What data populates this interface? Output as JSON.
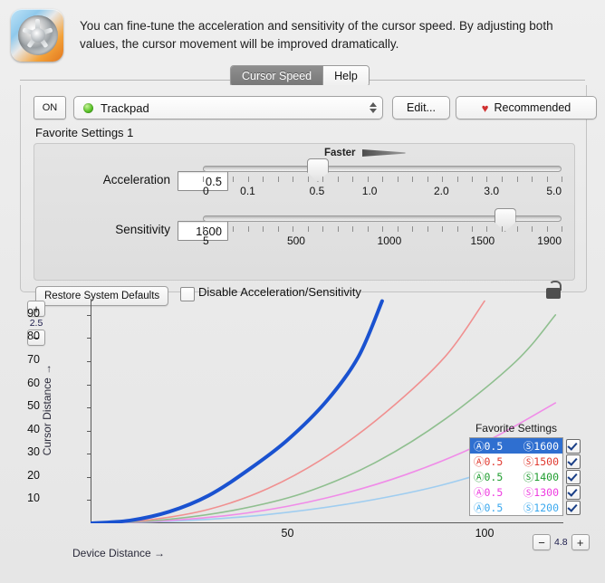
{
  "header": {
    "icon_name": "turbine-app-icon",
    "description": "You can fine-tune the acceleration and sensitivity of the cursor speed. By adjusting both values, the cursor movement will be improved dramatically."
  },
  "tabs": [
    {
      "label": "Cursor Speed",
      "active": true
    },
    {
      "label": "Help",
      "active": false
    }
  ],
  "toolbar": {
    "on_label": "ON",
    "device_value": "Trackpad",
    "device_led_color": "#5cc52a",
    "edit_label": "Edit...",
    "recommended_label": "Recommended",
    "heart_glyph": "♥",
    "help_label": "?"
  },
  "favorite": {
    "group_label": "Favorite Settings 1",
    "faster_label": "Faster"
  },
  "sliders": [
    {
      "name": "acceleration",
      "label": "Acceleration",
      "value": "0.5",
      "thumb_pct": 31.8,
      "ticks": 25,
      "tick_labels": [
        {
          "text": "0",
          "pct": 0
        },
        {
          "text": "0.1",
          "pct": 12.5
        },
        {
          "text": "0.5",
          "pct": 31.8
        },
        {
          "text": "1.0",
          "pct": 46.5
        },
        {
          "text": "2.0",
          "pct": 66.5
        },
        {
          "text": "3.0",
          "pct": 80.5
        },
        {
          "text": "5.0",
          "pct": 100
        }
      ]
    },
    {
      "name": "sensitivity",
      "label": "Sensitivity",
      "value": "1600",
      "thumb_pct": 84.0,
      "ticks": 25,
      "tick_labels": [
        {
          "text": "5",
          "pct": 0
        },
        {
          "text": "500",
          "pct": 26
        },
        {
          "text": "1000",
          "pct": 52
        },
        {
          "text": "1500",
          "pct": 78
        },
        {
          "text": "1900",
          "pct": 100
        }
      ]
    }
  ],
  "bottom": {
    "restore_label": "Restore System Defaults",
    "disable_label": "Disable Acceleration/Sensitivity",
    "disable_checked": false,
    "lock_state": "unlocked"
  },
  "chart_data": {
    "type": "line",
    "title": "",
    "xlabel": "Device Distance",
    "ylabel": "Cursor Distance",
    "xlim": [
      0,
      120
    ],
    "ylim": [
      0,
      97
    ],
    "x_ticks": [
      {
        "value": 50,
        "label": "50"
      },
      {
        "value": 100,
        "label": "100"
      }
    ],
    "y_ticks": [
      {
        "value": 10,
        "label": "10"
      },
      {
        "value": 20,
        "label": "20"
      },
      {
        "value": 30,
        "label": "30"
      },
      {
        "value": 40,
        "label": "40"
      },
      {
        "value": 50,
        "label": "50"
      },
      {
        "value": 60,
        "label": "60"
      },
      {
        "value": 70,
        "label": "70"
      },
      {
        "value": 80,
        "label": "80"
      },
      {
        "value": 90,
        "label": "90"
      }
    ],
    "grid": false,
    "legend_position": "bottom-right",
    "y_zoom": "2.5",
    "x_zoom": "4.8",
    "series": [
      {
        "name": "A0.5 S1600",
        "acceleration": "0.5",
        "sensitivity": "1600",
        "color": "#1a52d0",
        "width": 4,
        "selected": true,
        "enabled": true,
        "points": [
          [
            0,
            0
          ],
          [
            10,
            1.2
          ],
          [
            20,
            5
          ],
          [
            30,
            12
          ],
          [
            40,
            23
          ],
          [
            50,
            36
          ],
          [
            60,
            53
          ],
          [
            68,
            72
          ],
          [
            74,
            96
          ]
        ]
      },
      {
        "name": "A0.5 S1500",
        "acceleration": "0.5",
        "sensitivity": "1500",
        "color": "#f09090",
        "width": 1.6,
        "selected": false,
        "enabled": true,
        "points": [
          [
            0,
            0
          ],
          [
            15,
            1.5
          ],
          [
            30,
            6
          ],
          [
            45,
            15
          ],
          [
            60,
            29
          ],
          [
            75,
            48
          ],
          [
            90,
            72
          ],
          [
            100,
            96
          ]
        ]
      },
      {
        "name": "A0.5 S1400",
        "acceleration": "0.5",
        "sensitivity": "1400",
        "color": "#8fbf8f",
        "width": 1.6,
        "selected": false,
        "enabled": true,
        "points": [
          [
            0,
            0
          ],
          [
            18,
            1.4
          ],
          [
            36,
            5.5
          ],
          [
            54,
            13
          ],
          [
            72,
            26
          ],
          [
            90,
            45
          ],
          [
            108,
            70
          ],
          [
            118,
            90
          ]
        ]
      },
      {
        "name": "A0.5 S1300",
        "acceleration": "0.5",
        "sensitivity": "1300",
        "color": "#f08ce8",
        "width": 1.6,
        "selected": false,
        "enabled": true,
        "points": [
          [
            0,
            0
          ],
          [
            20,
            1.2
          ],
          [
            40,
            4.5
          ],
          [
            60,
            11
          ],
          [
            80,
            21
          ],
          [
            100,
            35
          ],
          [
            118,
            52
          ]
        ]
      },
      {
        "name": "A0.5 S1200",
        "acceleration": "0.5",
        "sensitivity": "1200",
        "color": "#9fcdf0",
        "width": 1.6,
        "selected": false,
        "enabled": true,
        "points": [
          [
            0,
            0
          ],
          [
            22,
            1
          ],
          [
            44,
            3.6
          ],
          [
            66,
            8.5
          ],
          [
            88,
            16
          ],
          [
            110,
            27
          ],
          [
            120,
            33
          ]
        ]
      }
    ],
    "legend_title": "Favorite Settings",
    "legend_rows": [
      {
        "a_glyph": "Ⓐ",
        "a": "0.5",
        "s_glyph": "Ⓢ",
        "s": "1600",
        "color": "#1a52d0",
        "checked": true,
        "selected": true
      },
      {
        "a_glyph": "Ⓐ",
        "a": "0.5",
        "s_glyph": "Ⓢ",
        "s": "1500",
        "color": "#e03a30",
        "checked": true,
        "selected": false
      },
      {
        "a_glyph": "Ⓐ",
        "a": "0.5",
        "s_glyph": "Ⓢ",
        "s": "1400",
        "color": "#1f9d2f",
        "checked": true,
        "selected": false
      },
      {
        "a_glyph": "Ⓐ",
        "a": "0.5",
        "s_glyph": "Ⓢ",
        "s": "1300",
        "color": "#ee3ce0",
        "checked": true,
        "selected": false
      },
      {
        "a_glyph": "Ⓐ",
        "a": "0.5",
        "s_glyph": "Ⓢ",
        "s": "1200",
        "color": "#3aa8ee",
        "checked": true,
        "selected": false
      }
    ]
  }
}
